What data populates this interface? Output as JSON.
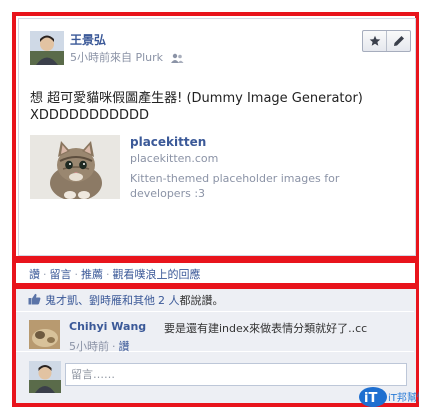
{
  "post": {
    "author": "王景弘",
    "meta": "5小時前來自 Plurk",
    "text": "想 超可愛貓咪假圖產生器! (Dummy Image Generator) XDDDDDDDDDDD",
    "toolbar": {
      "star_icon": "star-icon",
      "edit_icon": "pencil-icon"
    },
    "link": {
      "title": "placekitten",
      "domain": "placekitten.com",
      "description": "Kitten-themed placeholder images for developers :3"
    }
  },
  "actions": {
    "like": "讚",
    "comment": "留言",
    "share": "推薦",
    "view_on_plurk": "觀看噗浪上的回應",
    "separator": "·"
  },
  "likes": {
    "names": "鬼才凱、劉時雁和其他",
    "count_link": "2 人",
    "suffix": "都說讚。"
  },
  "comment": {
    "author": "Chihyi Wang",
    "text": "要是還有建index來做表情分類就好了..cc",
    "time": "5小時前",
    "like": "讚"
  },
  "compose": {
    "placeholder": "留言……"
  },
  "watermark": {
    "text": "iT邦幫忙"
  },
  "colors": {
    "highlight": "#e8141c",
    "link": "#3b5998",
    "meta": "#8b93a6",
    "feedback_bg": "#edeff4"
  }
}
